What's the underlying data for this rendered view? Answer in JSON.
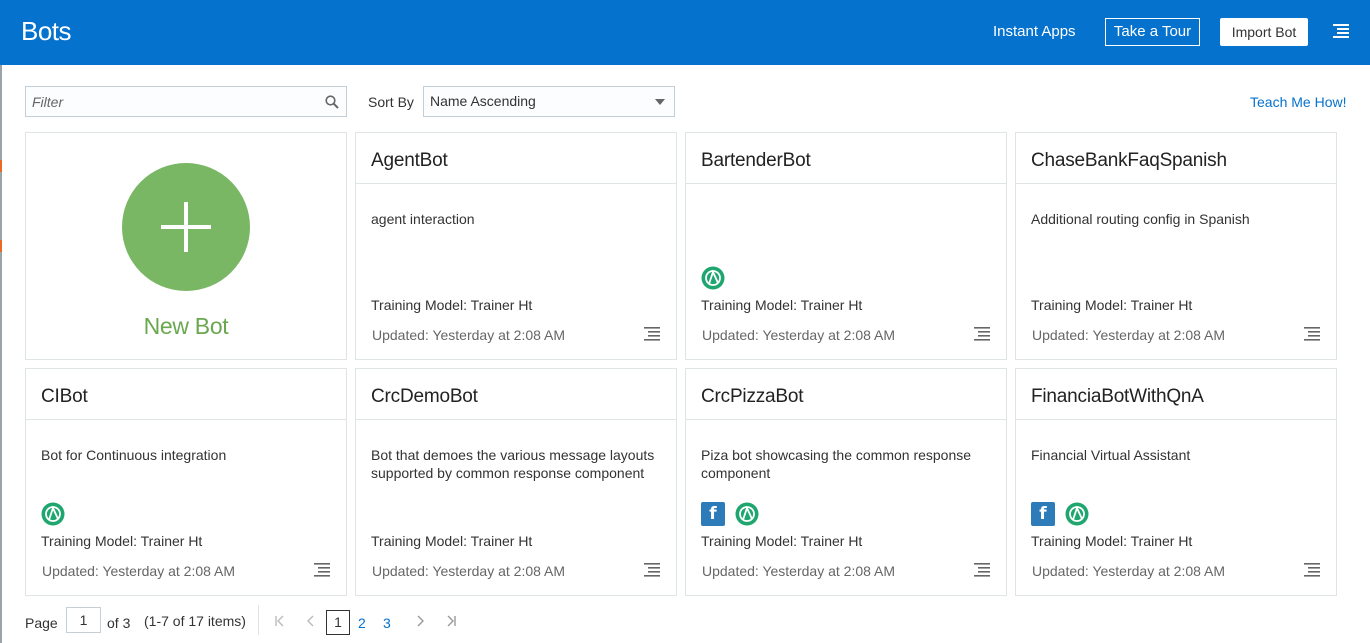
{
  "header": {
    "title": "Bots",
    "instant_apps": "Instant Apps",
    "take_tour": "Take a Tour",
    "import_bot": "Import Bot",
    "background_color": "#0572ce"
  },
  "toolbar": {
    "filter_placeholder": "Filter",
    "sort_label": "Sort By",
    "sort_value": "Name Ascending",
    "teach_link": "Teach Me How!"
  },
  "new_bot": {
    "label": "New Bot",
    "icon": "plus-icon",
    "accent_color": "#7ab765"
  },
  "bots": [
    {
      "name": "AgentBot",
      "description": "agent interaction",
      "channels": [],
      "training": "Training Model: Trainer Ht",
      "updated": "Updated: Yesterday at 2:08 AM"
    },
    {
      "name": "BartenderBot",
      "description": "",
      "channels": [
        "digital-assistant"
      ],
      "training": "Training Model: Trainer Ht",
      "updated": "Updated: Yesterday at 2:08 AM"
    },
    {
      "name": "ChaseBankFaqSpanish",
      "description": "Additional routing config in Spanish",
      "channels": [],
      "training": "Training Model: Trainer Ht",
      "updated": "Updated: Yesterday at 2:08 AM"
    },
    {
      "name": "CIBot",
      "description": "Bot for Continuous integration",
      "channels": [
        "digital-assistant"
      ],
      "training": "Training Model: Trainer Ht",
      "updated": "Updated: Yesterday at 2:08 AM"
    },
    {
      "name": "CrcDemoBot",
      "description": "Bot that demoes the various message layouts supported by common response component",
      "channels": [],
      "training": "Training Model: Trainer Ht",
      "updated": "Updated: Yesterday at 2:08 AM"
    },
    {
      "name": "CrcPizzaBot",
      "description": "Piza bot showcasing the common response component",
      "channels": [
        "facebook",
        "digital-assistant"
      ],
      "training": "Training Model: Trainer Ht",
      "updated": "Updated: Yesterday at 2:08 AM"
    },
    {
      "name": "FinanciaBotWithQnA",
      "description": "Financial Virtual Assistant",
      "channels": [
        "facebook",
        "digital-assistant"
      ],
      "training": "Training Model: Trainer Ht",
      "updated": "Updated: Yesterday at 2:08 AM"
    }
  ],
  "pagination": {
    "page_label": "Page",
    "current_page": "1",
    "of_label": "of 3",
    "items_label": "(1-7 of 17 items)",
    "pages": [
      "1",
      "2",
      "3"
    ],
    "first_icon": "first-page-icon",
    "prev_icon": "prev-page-icon",
    "next_icon": "next-page-icon",
    "last_icon": "last-page-icon"
  },
  "colors": {
    "link": "#0572ce",
    "facebook": "#2d7bb8",
    "digital_assistant": "#1fa66f"
  }
}
